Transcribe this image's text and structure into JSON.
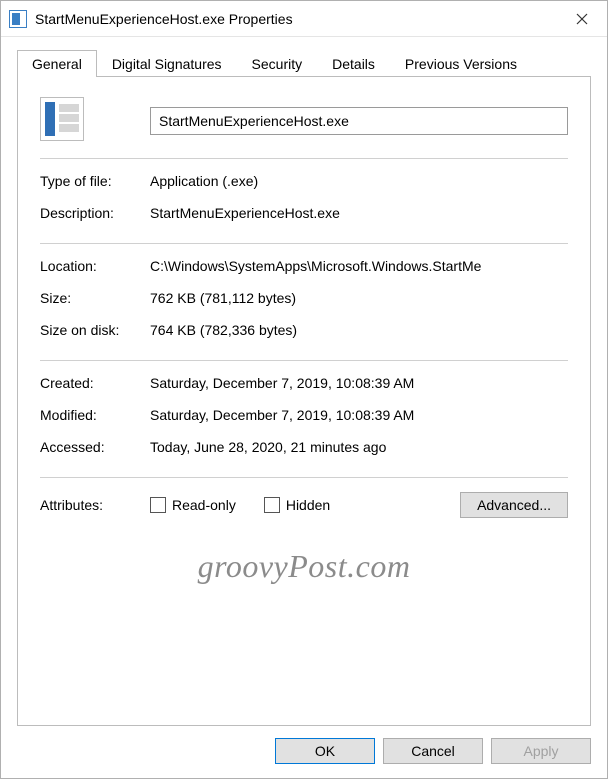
{
  "titlebar": {
    "title": "StartMenuExperienceHost.exe Properties"
  },
  "tabs": [
    "General",
    "Digital Signatures",
    "Security",
    "Details",
    "Previous Versions"
  ],
  "activeTab": 0,
  "general": {
    "filename": "StartMenuExperienceHost.exe",
    "type_label": "Type of file:",
    "type_value": "Application (.exe)",
    "desc_label": "Description:",
    "desc_value": "StartMenuExperienceHost.exe",
    "loc_label": "Location:",
    "loc_value": "C:\\Windows\\SystemApps\\Microsoft.Windows.StartMe",
    "size_label": "Size:",
    "size_value": "762 KB (781,112 bytes)",
    "sod_label": "Size on disk:",
    "sod_value": "764 KB (782,336 bytes)",
    "created_label": "Created:",
    "created_value": "Saturday, December 7, 2019, 10:08:39 AM",
    "modified_label": "Modified:",
    "modified_value": "Saturday, December 7, 2019, 10:08:39 AM",
    "accessed_label": "Accessed:",
    "accessed_value": "Today, June 28, 2020, 21 minutes ago",
    "attrs_label": "Attributes:",
    "readonly_label": "Read-only",
    "hidden_label": "Hidden",
    "advanced_label": "Advanced..."
  },
  "watermark": "groovyPost.com",
  "footer": {
    "ok": "OK",
    "cancel": "Cancel",
    "apply": "Apply"
  }
}
